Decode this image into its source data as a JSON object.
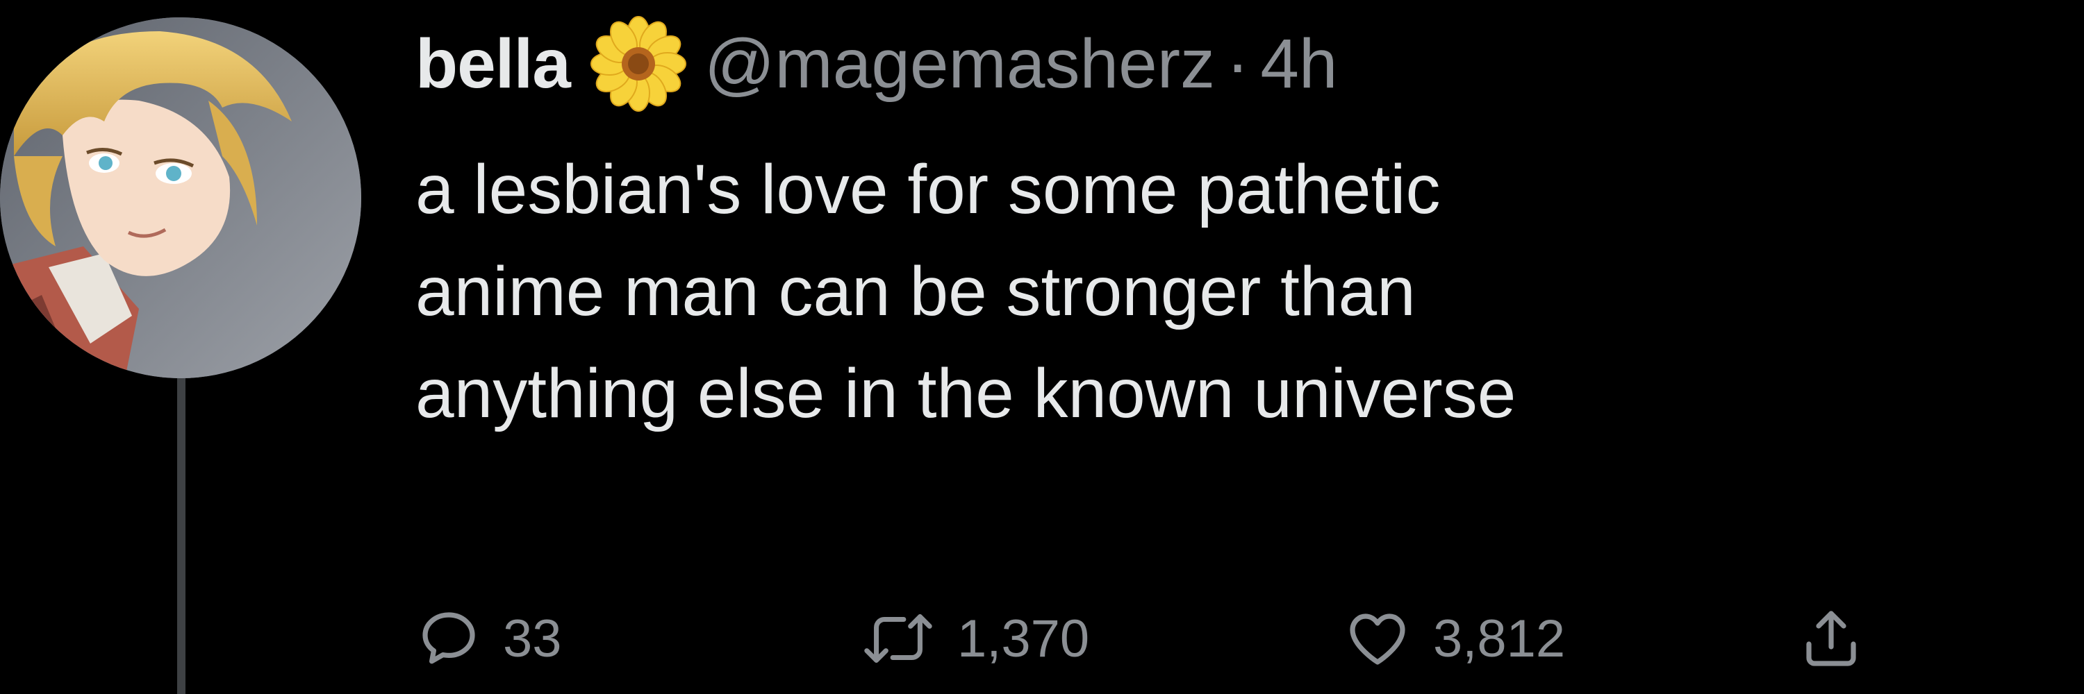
{
  "tweet": {
    "display_name": "bella",
    "badge_icon": "sunflower-emoji-icon",
    "handle": "@magemasherz",
    "separator": "·",
    "time": "4h",
    "text_lines": [
      "a lesbian's love for some pathetic",
      "anime man can be stronger than",
      "anything else in the known universe"
    ],
    "actions": {
      "reply": {
        "icon": "reply-bubble-icon",
        "count": "33"
      },
      "retweet": {
        "icon": "retweet-icon",
        "count": "1,370"
      },
      "like": {
        "icon": "heart-icon",
        "count": "3,812"
      },
      "share": {
        "icon": "share-icon"
      }
    }
  },
  "colors": {
    "background": "#000000",
    "primary_text": "#e7e9ea",
    "secondary_text": "#8b8f94",
    "thread_line": "#3e4144"
  }
}
